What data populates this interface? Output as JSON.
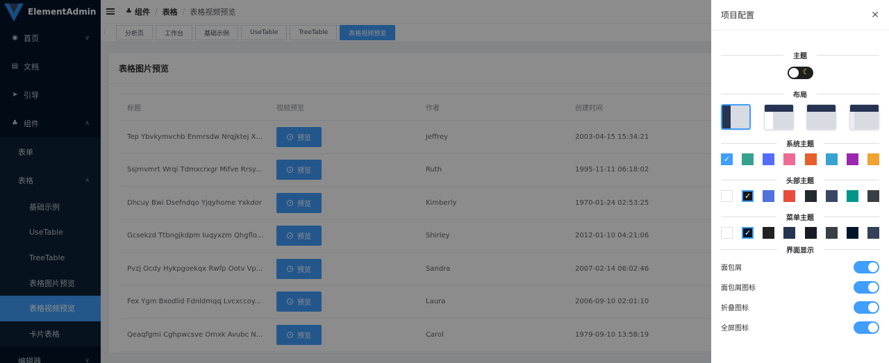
{
  "sidebar": {
    "logo_text": "ElementAdmin",
    "items": [
      {
        "label": "首页",
        "icon": "dashboard-icon",
        "chevron": "∨"
      },
      {
        "label": "文档",
        "icon": "document-icon"
      },
      {
        "label": "引导",
        "icon": "send-icon"
      },
      {
        "label": "组件",
        "icon": "component-icon",
        "chevron": "∧"
      }
    ],
    "sub_items": [
      {
        "label": "表单"
      },
      {
        "label": "表格",
        "chevron": "∧"
      }
    ],
    "table_items": [
      {
        "label": "基础示例"
      },
      {
        "label": "UseTable"
      },
      {
        "label": "TreeTable"
      },
      {
        "label": "表格图片预览"
      },
      {
        "label": "表格视频预览"
      },
      {
        "label": "卡片表格"
      }
    ],
    "bottom_item": {
      "label": "编辑器",
      "chevron": "∨"
    }
  },
  "header": {
    "breadcrumb": [
      "组件",
      "表格",
      "表格视频预览"
    ]
  },
  "tags": [
    "分析页",
    "工作台",
    "基础示例",
    "UseTable",
    "TreeTable",
    "表格视频预览"
  ],
  "card": {
    "title": "表格图片预览",
    "columns": [
      "标题",
      "视频预览",
      "作者",
      "创建时间"
    ],
    "preview_label": "预览",
    "rows": [
      {
        "title": "Tep Ybvkymvchb Enmrsdw Nrqjktej X...",
        "author": "Jeffrey",
        "time": "2003-04-15 15:34:21"
      },
      {
        "title": "Ssjmvmrt Wrqi Tdmxcrxgr Mifve Rrsy...",
        "author": "Ruth",
        "time": "1995-11-11 06:18:02"
      },
      {
        "title": "Dhcuy Bwi Dsefndqo Yjqyhome Yxkdor",
        "author": "Kimberly",
        "time": "1970-01-24 02:53:25"
      },
      {
        "title": "Gcsekzd Ttbngjkdpm Iuqyxzm Qhgflo...",
        "author": "Shirley",
        "time": "2012-01-10 04:21:06"
      },
      {
        "title": "Pvzj Ocdy Hykpgoekqx Rwfp Ootv Vp...",
        "author": "Sandra",
        "time": "2007-02-14 06:02:46"
      },
      {
        "title": "Fex Ygm Bxodlid Fdnldmqq Lvcxccoy...",
        "author": "Laura",
        "time": "2006-09-10 02:01:10"
      },
      {
        "title": "Qeaqfgmi Cghpwcsve Omxk Avubc N...",
        "author": "Carol",
        "time": "1979-09-10 13:58:19"
      }
    ]
  },
  "panel": {
    "title": "项目配置",
    "sections": {
      "theme": "主题",
      "layout": "布局",
      "system_theme": "系统主题",
      "header_theme": "头部主题",
      "menu_theme": "菜单主题",
      "display": "界面显示"
    },
    "system_colors": [
      "#409eff",
      "#36a18d",
      "#536dfe",
      "#ee6b94",
      "#e65f2d",
      "#37a3cf",
      "#9c27b0",
      "#f0a232"
    ],
    "header_colors": [
      "#ffffff",
      "#151515",
      "#5172dc",
      "#e74c3c",
      "#24292e",
      "#394664",
      "#009688",
      "#383f45"
    ],
    "menu_colors": [
      "#ffffff",
      "#001529",
      "#212121",
      "#273352",
      "#191b24",
      "#383f45",
      "#001628",
      "#344058"
    ],
    "toggles": [
      {
        "label": "面包屑",
        "on": true
      },
      {
        "label": "面包屑图标",
        "on": true
      },
      {
        "label": "折叠图标",
        "on": true
      },
      {
        "label": "全屏图标",
        "on": true
      }
    ]
  }
}
